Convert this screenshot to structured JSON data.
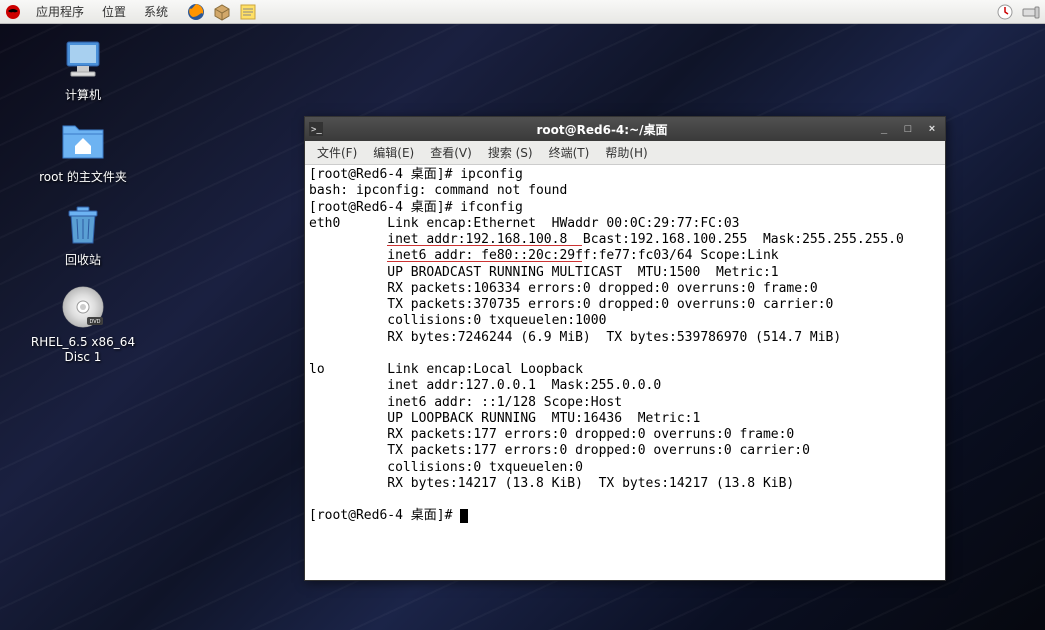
{
  "panel": {
    "menus": [
      "应用程序",
      "位置",
      "系统"
    ],
    "icons": [
      "firefox-icon",
      "package-icon",
      "notes-icon"
    ],
    "tray": [
      "update-icon",
      "volume-icon"
    ]
  },
  "desktop_icons": [
    {
      "name": "computer-icon",
      "label": "计算机"
    },
    {
      "name": "home-folder-icon",
      "label": "root 的主文件夹"
    },
    {
      "name": "trash-icon",
      "label": "回收站"
    },
    {
      "name": "dvd-icon",
      "label": "RHEL_6.5 x86_64\nDisc 1"
    }
  ],
  "terminal": {
    "title": "root@Red6-4:~/桌面",
    "menus": [
      "文件(F)",
      "编辑(E)",
      "查看(V)",
      "搜索 (S)",
      "终端(T)",
      "帮助(H)"
    ],
    "lines": [
      "[root@Red6-4 桌面]# ipconfig",
      "bash: ipconfig: command not found",
      "[root@Red6-4 桌面]# ifconfig",
      "eth0      Link encap:Ethernet  HWaddr 00:0C:29:77:FC:03",
      "          inet addr:192.168.100.8  Bcast:192.168.100.255  Mask:255.255.255.0",
      "          inet6 addr: fe80::20c:29ff:fe77:fc03/64 Scope:Link",
      "          UP BROADCAST RUNNING MULTICAST  MTU:1500  Metric:1",
      "          RX packets:106334 errors:0 dropped:0 overruns:0 frame:0",
      "          TX packets:370735 errors:0 dropped:0 overruns:0 carrier:0",
      "          collisions:0 txqueuelen:1000",
      "          RX bytes:7246244 (6.9 MiB)  TX bytes:539786970 (514.7 MiB)",
      "",
      "lo        Link encap:Local Loopback",
      "          inet addr:127.0.0.1  Mask:255.0.0.0",
      "          inet6 addr: ::1/128 Scope:Host",
      "          UP LOOPBACK RUNNING  MTU:16436  Metric:1",
      "          RX packets:177 errors:0 dropped:0 overruns:0 frame:0",
      "          TX packets:177 errors:0 dropped:0 overruns:0 carrier:0",
      "          collisions:0 txqueuelen:0",
      "          RX bytes:14217 (13.8 KiB)  TX bytes:14217 (13.8 KiB)",
      "",
      "[root@Red6-4 桌面]# "
    ]
  }
}
